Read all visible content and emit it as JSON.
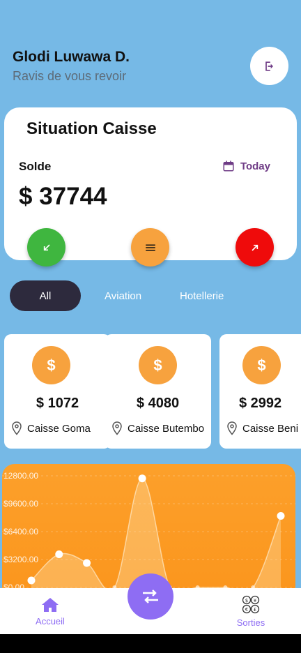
{
  "header": {
    "name": "Glodi Luwawa D.",
    "subtitle": "Ravis de vous revoir",
    "logout_icon": "logout-icon"
  },
  "caisse": {
    "title": "Situation Caisse",
    "solde_label": "Solde",
    "date_filter": "Today",
    "balance": "$ 37744",
    "actions": [
      {
        "name": "entree-button",
        "icon": "arrow-down-left-icon",
        "color": "#3fb63f"
      },
      {
        "name": "menu-button",
        "icon": "menu-icon",
        "color": "#f7a23e"
      },
      {
        "name": "sortie-button",
        "icon": "arrow-up-right-icon",
        "color": "#ef0b0b"
      }
    ]
  },
  "filters": {
    "items": [
      "All",
      "Aviation",
      "Hotellerie"
    ],
    "selected": "All"
  },
  "caisses": [
    {
      "amount": "$ 1072",
      "name": "Caisse Goma"
    },
    {
      "amount": "$ 4080",
      "name": "Caisse Butembo"
    },
    {
      "amount": "$ 2992",
      "name": "Caisse Beni"
    }
  ],
  "chart_data": {
    "type": "area",
    "y_tick_labels": [
      "12800.00",
      "$9600.00",
      "$6400.00",
      "$3200.00",
      "$0.00"
    ],
    "ylim": [
      0,
      12800
    ],
    "x": [
      1,
      2,
      3,
      4,
      5,
      6,
      7,
      8,
      9,
      10
    ],
    "values": [
      800,
      3800,
      2800,
      0,
      12500,
      0,
      0,
      0,
      0,
      8200
    ],
    "colors": {
      "background": "#fb9a25",
      "line": "#fff5e0"
    }
  },
  "nav": {
    "home_label": "Accueil",
    "exits_label": "Sorties",
    "transfer_icon": "transfer-icon",
    "accent": "#8e6df3"
  }
}
